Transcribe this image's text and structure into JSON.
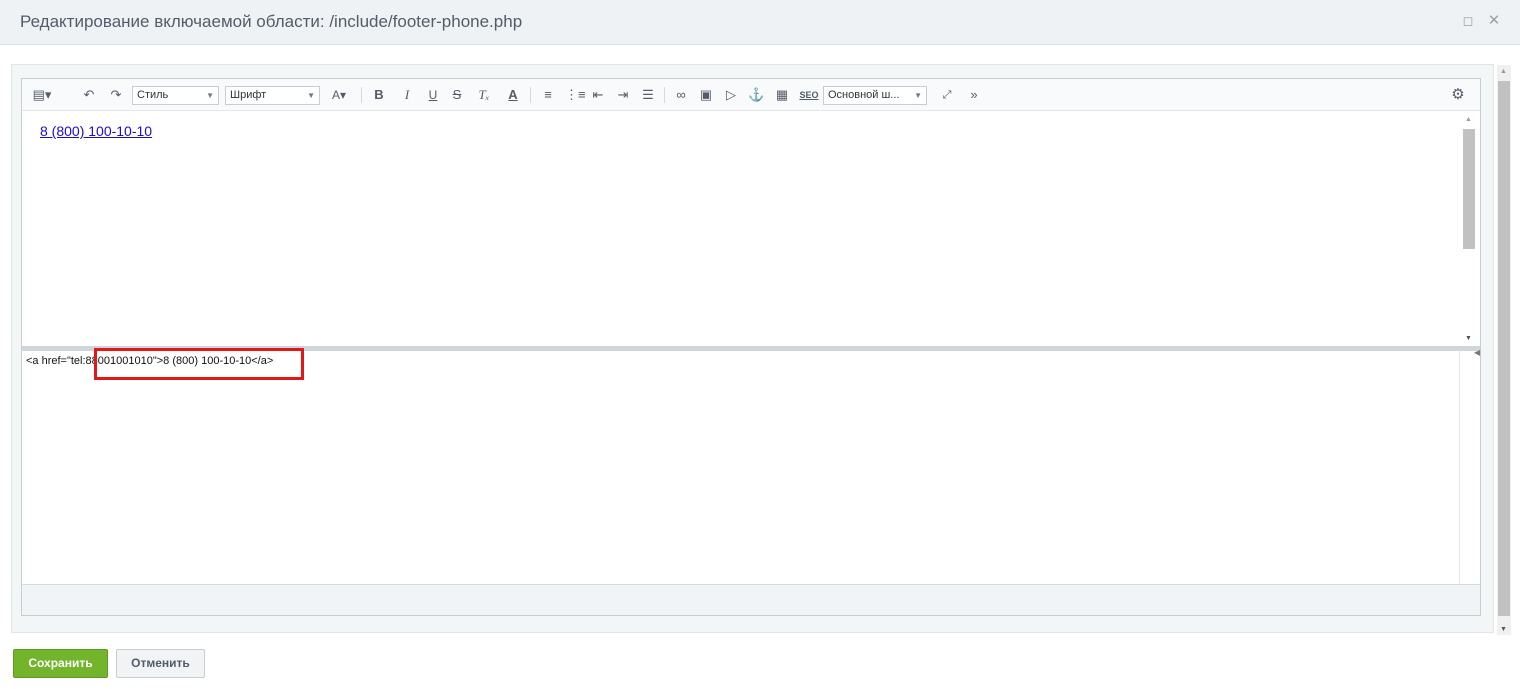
{
  "dialog": {
    "title": "Редактирование включаемой области: /include/footer-phone.php",
    "restore_icon": "restore-icon",
    "close_icon": "close-icon"
  },
  "toolbar": {
    "style_select": "Стиль",
    "font_select": "Шрифт",
    "template_select": "Основной ш...",
    "seo_label": "SEO",
    "icons": [
      "templates-icon",
      "undo-icon",
      "redo-icon",
      "font-size-icon",
      "bold-icon",
      "italic-icon",
      "underline-icon",
      "strikethrough-icon",
      "remove-format-icon",
      "text-color-icon",
      "ordered-list-icon",
      "unordered-list-icon",
      "outdent-icon",
      "indent-icon",
      "align-icon",
      "link-icon",
      "image-icon",
      "video-icon",
      "anchor-icon",
      "table-icon",
      "seo-icon",
      "fullscreen-icon",
      "more-icon",
      "settings-icon"
    ]
  },
  "editor": {
    "link_text": "8 (800) 100-10-10",
    "code_text": "<a href=\"tel:88001001010\">8 (800) 100-10-10</a>"
  },
  "footer": {
    "save_label": "Сохранить",
    "cancel_label": "Отменить"
  },
  "colors": {
    "save_button": "#72b42c",
    "link": "#1a0dcc",
    "highlight_border": "#e11818"
  }
}
